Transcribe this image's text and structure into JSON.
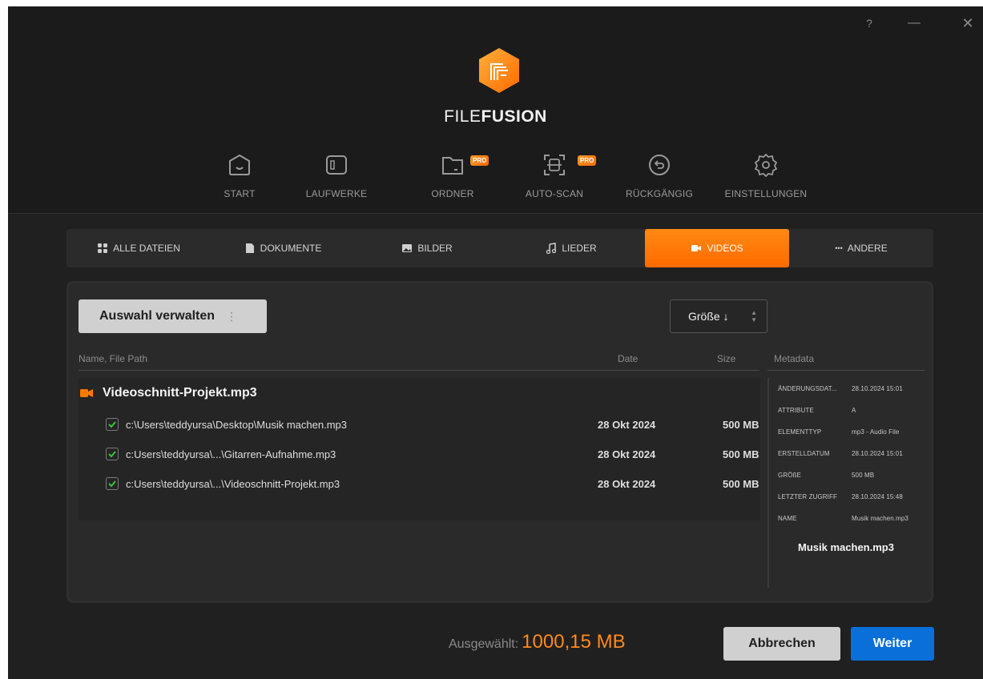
{
  "window": {
    "help_label": "?",
    "minimize_label": "—",
    "close_label": "✕"
  },
  "brand": {
    "name_light": "FILE",
    "name_bold": "FUSION"
  },
  "nav": [
    {
      "label": "START",
      "icon": "home-icon"
    },
    {
      "label": "LAUFWERKE",
      "icon": "drive-icon"
    },
    {
      "label": "ORDNER",
      "icon": "folder-icon",
      "badge": "PRO"
    },
    {
      "label": "AUTO-SCAN",
      "icon": "auto-scan-icon",
      "badge": "PRO"
    },
    {
      "label": "RÜCKGÄNGIG",
      "icon": "undo-icon"
    },
    {
      "label": "EINSTELLUNGEN",
      "icon": "gear-icon"
    }
  ],
  "tabs": [
    {
      "label": "ALLE DATEIEN",
      "icon": "grid-icon"
    },
    {
      "label": "DOKUMENTE",
      "icon": "document-icon"
    },
    {
      "label": "BILDER",
      "icon": "image-icon"
    },
    {
      "label": "LIEDER",
      "icon": "music-icon"
    },
    {
      "label": "VIDEOS",
      "icon": "video-icon",
      "active": true
    },
    {
      "label": "ANDERE",
      "icon": "dots-icon"
    }
  ],
  "toolbar": {
    "manage_label": "Auswahl verwalten",
    "manage_dots": "⋮",
    "sort_label": "Größe ↓"
  },
  "columns": {
    "name": "Name, File Path",
    "date": "Date",
    "size": "Size",
    "metadata": "Metadata"
  },
  "group": {
    "name": "Videoschnitt-Projekt.mp3"
  },
  "files": [
    {
      "path": "c:\\Users\\teddyursa\\Desktop\\Musik machen.mp3",
      "date": "28 Okt 2024",
      "size": "500 MB",
      "checked": true
    },
    {
      "path": "c:Users\\teddyursa\\...\\Gitarren-Aufnahme.mp3",
      "date": "28 Okt 2024",
      "size": "500 MB",
      "checked": true
    },
    {
      "path": "c:Users\\teddyursa\\...\\Videoschnitt-Projekt.mp3",
      "date": "28 Okt 2024",
      "size": "500 MB",
      "checked": true
    }
  ],
  "metadata": [
    {
      "key": "ÄNDERUNGSDAT...",
      "value": "28.10.2024 15:01"
    },
    {
      "key": "ATTRIBUTE",
      "value": "A"
    },
    {
      "key": "ELEMENTTYP",
      "value": "mp3 - Audio File"
    },
    {
      "key": "ERSTELLDATUM",
      "value": "28.10.2024 15:01"
    },
    {
      "key": "GRÖßE",
      "value": "500 MB"
    },
    {
      "key": "LETZTER ZUGRIFF",
      "value": "28.10.2024 15:48"
    },
    {
      "key": "NAME",
      "value": "Musik machen.mp3"
    }
  ],
  "metadata_name": "Musik machen.mp3",
  "footer": {
    "selected_label": "Ausgewählt:",
    "selected_value": "1000,15 MB",
    "cancel_label": "Abbrechen",
    "next_label": "Weiter"
  },
  "colors": {
    "accent": "#ff7a00",
    "primary_button": "#0a6fd8",
    "check": "#3fbf3f"
  }
}
